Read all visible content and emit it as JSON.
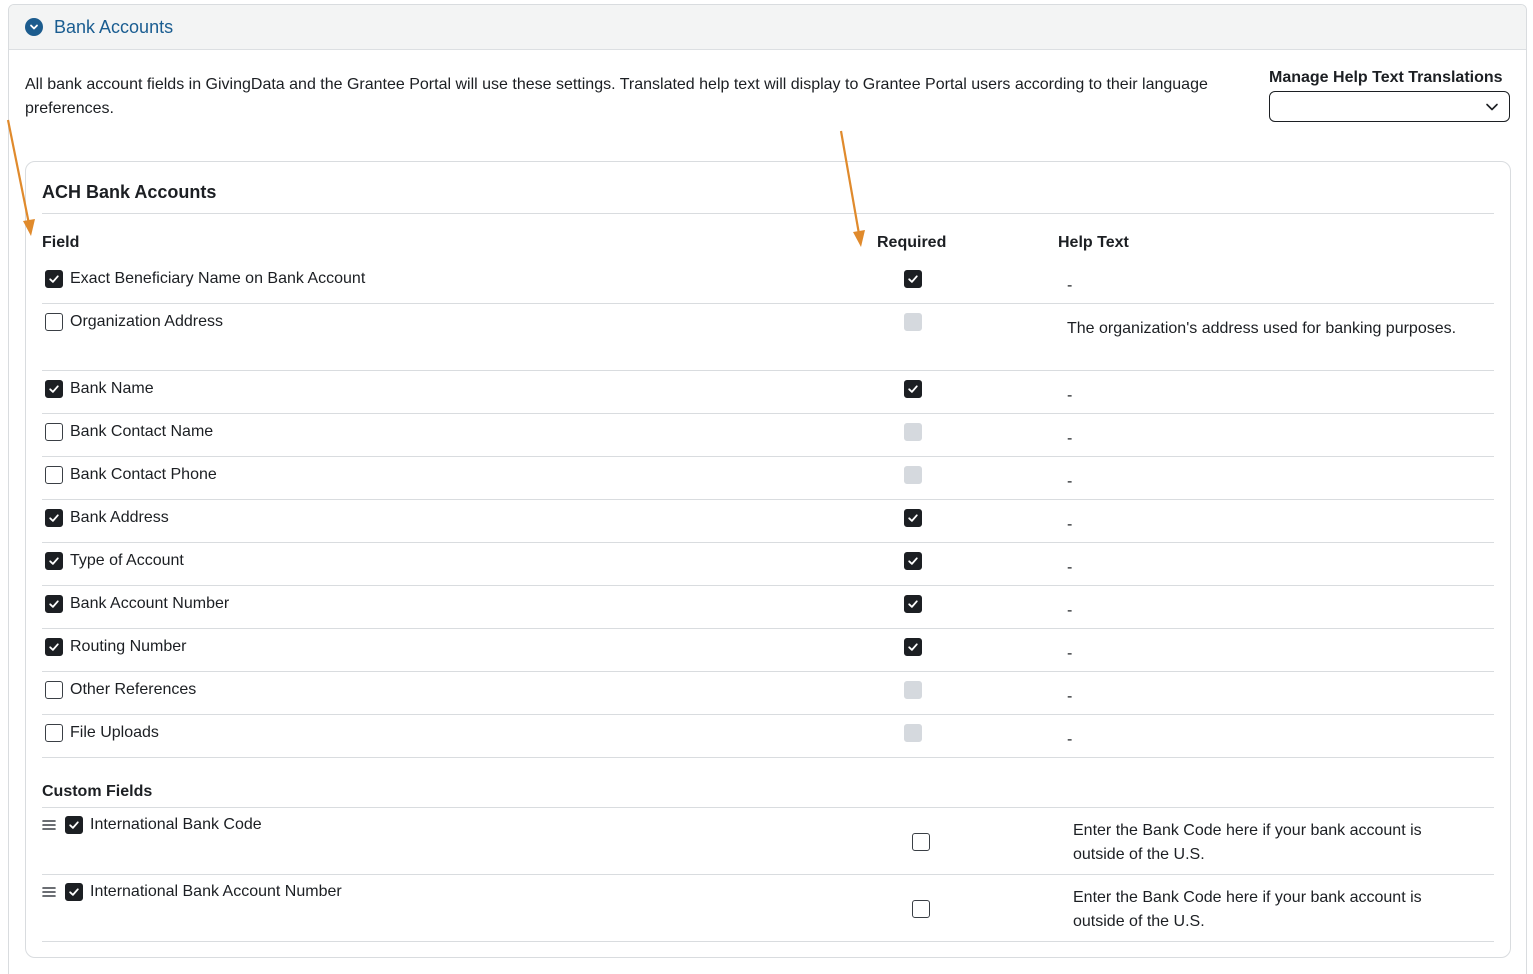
{
  "section": {
    "title": "Bank Accounts",
    "intro": "All bank account fields in GivingData and the Grantee Portal will use these settings. Translated help text will display to Grantee Portal users according to their language preferences."
  },
  "translations": {
    "label": "Manage Help Text Translations",
    "selected": ""
  },
  "ach": {
    "title": "ACH Bank Accounts",
    "columns": {
      "field": "Field",
      "required": "Required",
      "help": "Help Text"
    },
    "rows": [
      {
        "label": "Exact Beneficiary Name on Bank Account",
        "enabled": true,
        "required": true,
        "help": "-"
      },
      {
        "label": "Organization Address",
        "enabled": false,
        "required": false,
        "help": "The organization's address used for banking purposes."
      },
      {
        "label": "Bank Name",
        "enabled": true,
        "required": true,
        "help": "-"
      },
      {
        "label": "Bank Contact Name",
        "enabled": false,
        "required": false,
        "help": "-"
      },
      {
        "label": "Bank Contact Phone",
        "enabled": false,
        "required": false,
        "help": "-"
      },
      {
        "label": "Bank Address",
        "enabled": true,
        "required": true,
        "help": "-"
      },
      {
        "label": "Type of Account",
        "enabled": true,
        "required": true,
        "help": "-"
      },
      {
        "label": "Bank Account Number",
        "enabled": true,
        "required": true,
        "help": "-"
      },
      {
        "label": "Routing Number",
        "enabled": true,
        "required": true,
        "help": "-"
      },
      {
        "label": "Other References",
        "enabled": false,
        "required": false,
        "help": "-"
      },
      {
        "label": "File Uploads",
        "enabled": false,
        "required": false,
        "help": "-"
      }
    ]
  },
  "custom": {
    "title": "Custom Fields",
    "rows": [
      {
        "label": "International Bank Code",
        "enabled": true,
        "required": false,
        "help": "Enter the Bank Code here if your bank account is outside of the U.S."
      },
      {
        "label": "International Bank Account Number",
        "enabled": true,
        "required": false,
        "help": "Enter the Bank Code here if your bank account is outside of the U.S."
      }
    ]
  },
  "colors": {
    "header_title": "#1a5d91",
    "checkbox_on": "#1c1f23",
    "checkbox_disabled": "#d5d9de",
    "annotation_arrow": "#e08a2c"
  }
}
